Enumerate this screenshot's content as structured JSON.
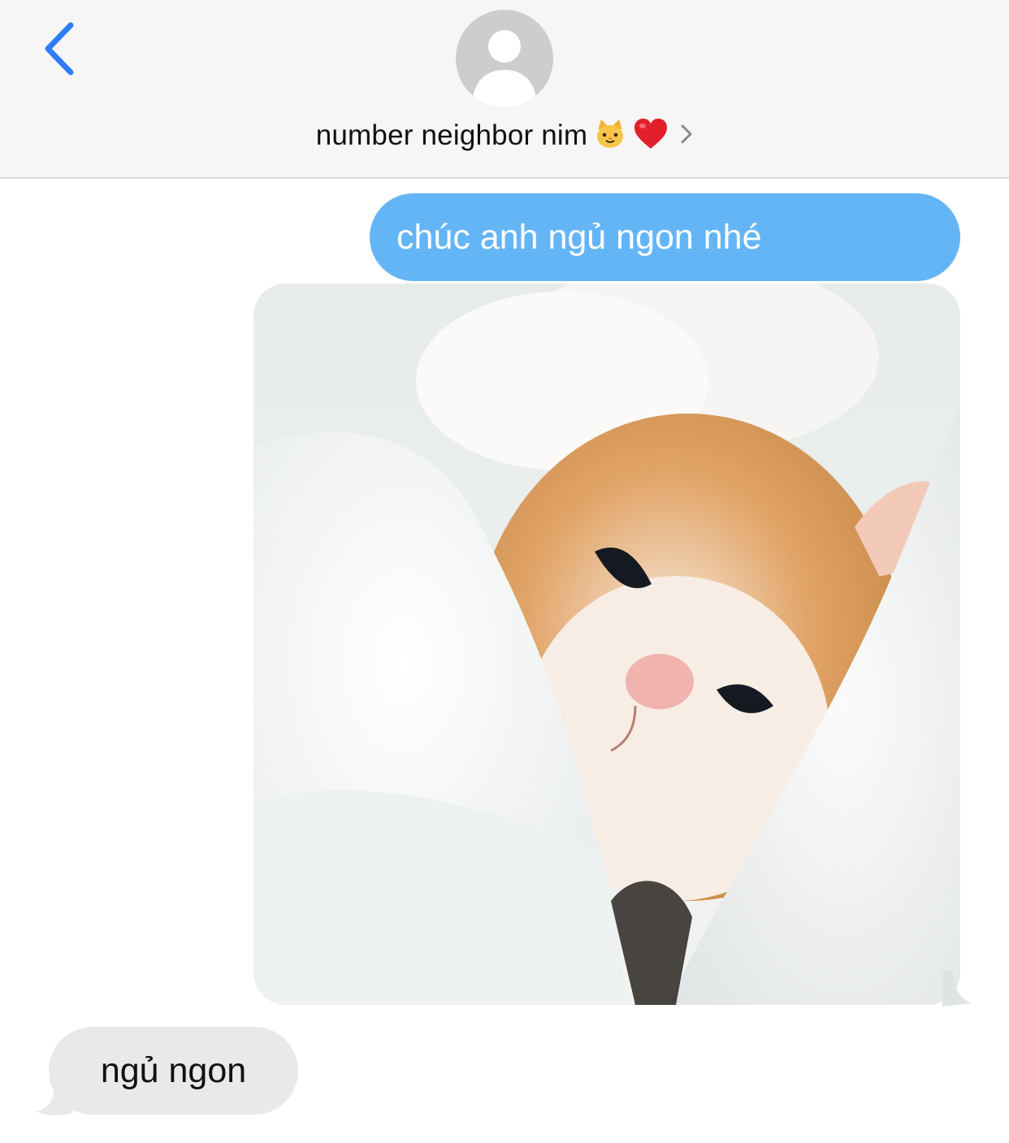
{
  "header": {
    "back_icon": "chevron-left-icon",
    "avatar_icon": "person-silhouette-icon",
    "contact_name": "number neighbor nim",
    "contact_emoji_1": "🐱",
    "contact_emoji_2": "❤️",
    "chevron_icon": "chevron-right-icon"
  },
  "messages": [
    {
      "direction": "sent",
      "type": "text",
      "text": "chúc anh ngủ ngon nhé"
    },
    {
      "direction": "sent",
      "type": "image",
      "alt": "kitten"
    },
    {
      "direction": "received",
      "type": "text",
      "text": "ngủ ngon"
    }
  ],
  "colors": {
    "accent": "#2f7cf6",
    "sent_bubble": "#64b5f6",
    "received_bubble": "#e9e9eb",
    "header_bg": "#f6f6f6",
    "avatar_bg": "#cdcdcf"
  }
}
